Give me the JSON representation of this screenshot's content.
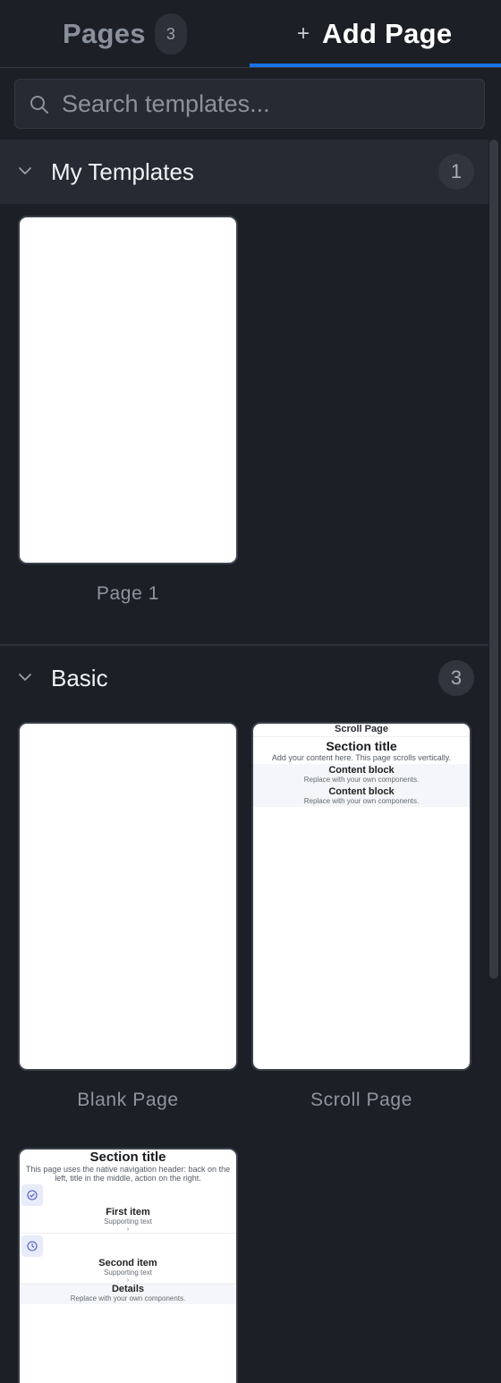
{
  "tabs": {
    "pages_label": "Pages",
    "pages_count": "3",
    "add_label": "Add Page",
    "active": "Add Page"
  },
  "search": {
    "placeholder": "Search templates..."
  },
  "sections": {
    "my_templates": {
      "title": "My Templates",
      "count": "1",
      "items": [
        {
          "name": "Page 1"
        }
      ]
    },
    "basic": {
      "title": "Basic",
      "count": "3",
      "items": [
        {
          "name": "Blank Page"
        },
        {
          "name": "Scroll Page",
          "thumb": {
            "header": "Scroll Page",
            "title": "Section title",
            "subtitle": "Add your content here. This page scrolls vertically.",
            "blocks": [
              {
                "title": "Content block",
                "text": "Replace with your own components."
              },
              {
                "title": "Content block",
                "text": "Replace with your own components."
              }
            ]
          }
        },
        {
          "name": "",
          "thumb": {
            "title": "Section title",
            "subtitle": "This page uses the native navigation header: back on the left, title in the middle, action on the right.",
            "rows": [
              {
                "title": "First item",
                "text": "Supporting text",
                "chevron": "›",
                "icon": "check-circle-icon"
              },
              {
                "title": "Second item",
                "text": "Supporting text",
                "chevron": "›",
                "icon": "clock-icon"
              }
            ],
            "details_title": "Details",
            "details_text": "Replace with your own components."
          }
        }
      ]
    }
  },
  "colors": {
    "background": "#1c1f26",
    "accent": "#1a73e8",
    "card": "#ffffff"
  }
}
